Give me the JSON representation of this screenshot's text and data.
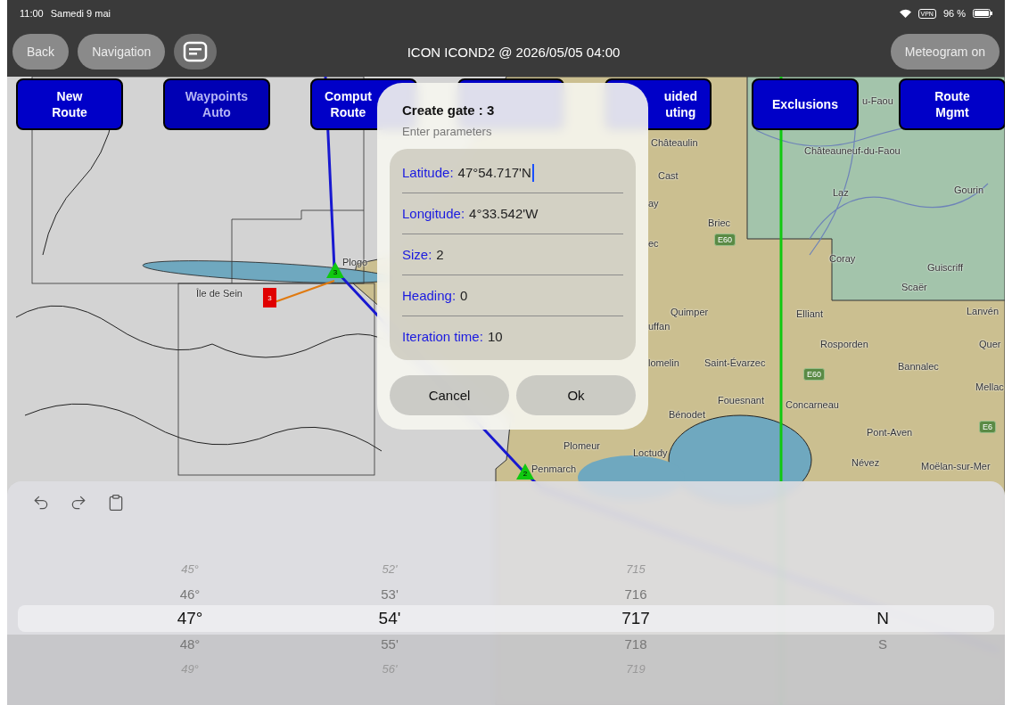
{
  "status_bar": {
    "time": "11:00",
    "date": "Samedi 9 mai",
    "vpn": "VPN",
    "battery": "96 %"
  },
  "nav_bar": {
    "buttons": [
      {
        "label": "Back",
        "disabled": true
      },
      {
        "label": "Navigation",
        "disabled": true
      }
    ],
    "title": "ICON ICOND2 @ 2026/05/05 04:00",
    "right_button": {
      "label": "Meteogram on",
      "disabled": true
    }
  },
  "route_buttons": [
    {
      "label": "New Route",
      "disabled": false
    },
    {
      "label": "Waypoints Auto",
      "disabled": true
    },
    {
      "label": "Comput Route",
      "disabled": false
    },
    {
      "disabled": false
    },
    {
      "label": "uided uting",
      "disabled": false
    },
    {
      "label": "Exclusions",
      "disabled": false
    },
    {
      "label": "Route Mgmt",
      "disabled": false
    }
  ],
  "map": {
    "places": [
      "u-Faou",
      "Châteaulin",
      "Cast",
      "ay",
      "ec",
      "uffan",
      "lomelin",
      "Briec",
      "Châteauneuf-du-Faou",
      "Laz",
      "Gourin",
      "Coray",
      "Guiscriff",
      "Scaër",
      "Elliant",
      "Lanvén",
      "Rosporden",
      "Quer",
      "Bannalec",
      "Mellac",
      "Quimper",
      "Saint-Évarzec",
      "Fouesnant",
      "Concarneau",
      "Bénodet",
      "Pont-Aven",
      "Loctudy",
      "Névez",
      "Moëlan-sur-Mer",
      "Plomeur",
      "Penmarch",
      "Île de Sein",
      "Plogo"
    ],
    "road_badges": [
      "E60",
      "E60",
      "E6"
    ],
    "markers": [
      {
        "kind": "gate",
        "label": "3"
      },
      {
        "kind": "waypoint",
        "label": "3"
      },
      {
        "kind": "waypoint",
        "label": "2"
      }
    ]
  },
  "dialog": {
    "title": "Create gate : 3",
    "subtitle": "Enter parameters",
    "fields": [
      {
        "label": "Latitude:",
        "value": "47°54.717'N",
        "focused": true
      },
      {
        "label": "Longitude:",
        "value": "4°33.542'W",
        "focused": false
      },
      {
        "label": "Size:",
        "value": "2",
        "focused": false
      },
      {
        "label": "Heading:",
        "value": "0",
        "focused": false
      },
      {
        "label": "Iteration time:",
        "value": "10",
        "focused": false
      }
    ],
    "buttons": [
      "Cancel",
      "Ok"
    ]
  },
  "picker": {
    "columns": [
      {
        "items": [
          {
            "label": "45°",
            "selected": false
          },
          {
            "label": "46°",
            "selected": false
          },
          {
            "label": "47°",
            "selected": true
          },
          {
            "label": "48°",
            "selected": false
          },
          {
            "label": "49°",
            "selected": false
          }
        ]
      },
      {
        "items": [
          {
            "label": "52'",
            "selected": false
          },
          {
            "label": "53'",
            "selected": false
          },
          {
            "label": "54'",
            "selected": true
          },
          {
            "label": "55'",
            "selected": false
          },
          {
            "label": "56'",
            "selected": false
          }
        ]
      },
      {
        "items": [
          {
            "label": "715",
            "selected": false
          },
          {
            "label": "716",
            "selected": false
          },
          {
            "label": "717",
            "selected": true
          },
          {
            "label": "718",
            "selected": false
          },
          {
            "label": "719",
            "selected": false
          }
        ]
      },
      {
        "items": [
          {
            "label": "N",
            "selected": true
          },
          {
            "label": "S",
            "selected": false
          }
        ]
      }
    ]
  }
}
